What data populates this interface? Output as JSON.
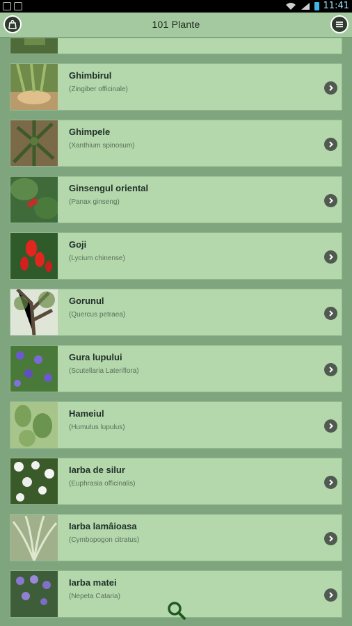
{
  "status_bar": {
    "time": "11:41"
  },
  "header": {
    "title": "101 Plante"
  },
  "icons": {
    "left_button": "bag-icon",
    "right_button": "menu-icon",
    "row_action": "chevron-right-icon",
    "search": "search-icon"
  },
  "colors": {
    "background": "#7fa57f",
    "row": "#b4d8ac",
    "header": "#a4c9a0"
  },
  "plants": [
    {
      "name": "Ghimbirul",
      "latin": "(Zingiber officinale)"
    },
    {
      "name": "Ghimpele",
      "latin": "(Xanthium spinosum)"
    },
    {
      "name": "Ginsengul oriental",
      "latin": "(Panax ginseng)"
    },
    {
      "name": "Goji",
      "latin": "(Lycium chinense)"
    },
    {
      "name": "Gorunul",
      "latin": "(Quercus petraea)"
    },
    {
      "name": "Gura lupului",
      "latin": "(Scutellaria Lateriflora)"
    },
    {
      "name": "Hameiul",
      "latin": "(Humulus lupulus)"
    },
    {
      "name": "Iarba de silur",
      "latin": "(Euphrasia officinalis)"
    },
    {
      "name": "Iarba lamâioasa",
      "latin": "(Cymbopogon citratus)"
    },
    {
      "name": "Iarba matei",
      "latin": "(Nepeta Cataria)"
    }
  ]
}
